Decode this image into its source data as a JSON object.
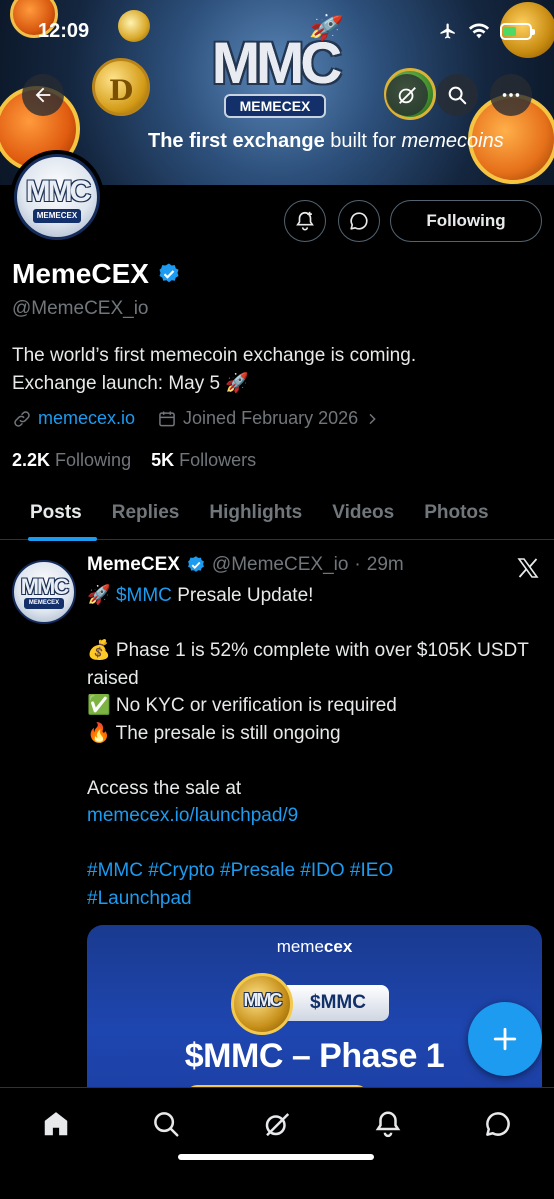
{
  "status_bar": {
    "time": "12:09"
  },
  "banner": {
    "logo_text": "MMC",
    "logo_ribbon": "MEMECEX",
    "tagline_bold": "The first exchange",
    "tagline_regular": "built for",
    "tagline_italic": "memecoins",
    "coin_label": "D"
  },
  "profile": {
    "avatar_logo_text": "MMC",
    "avatar_ribbon": "MEMECEX",
    "display_name": "MemeCEX",
    "handle": "@MemeCEX_io",
    "bio_line1": "The world’s first memecoin exchange is coming.",
    "bio_line2": "Exchange launch: May 5 🚀",
    "website": "memecex.io",
    "joined": "Joined February 2026",
    "following_count": "2.2K",
    "following_label": "Following",
    "followers_count": "5K",
    "followers_label": "Followers",
    "following_button": "Following"
  },
  "tabs": [
    "Posts",
    "Replies",
    "Highlights",
    "Videos",
    "Photos"
  ],
  "active_tab": "Posts",
  "tweet": {
    "author_name": "MemeCEX",
    "author_handle": "@MemeCEX_io",
    "separator": "·",
    "time_ago": "29m",
    "line1_emoji": "🚀",
    "line1_cashtag": "$MMC",
    "line1_text": "Presale Update!",
    "line2": "💰 Phase 1 is 52% complete with over $105K USDT raised",
    "line3": "✅ No KYC or verification is required",
    "line4": "🔥 The presale is still ongoing",
    "line5": "Access the sale at",
    "link": "memecex.io/launchpad/9",
    "hashtags_line1": "#MMC #Crypto #Presale #IDO #IEO",
    "hashtags_line2": "#Launchpad"
  },
  "media": {
    "brand_prefix": "meme",
    "brand_suffix": "cex",
    "coin_logo_text": "MMC",
    "ticker": "$MMC",
    "title": "$MMC – Phase 1"
  },
  "colors": {
    "accent": "#1d9bf0",
    "background": "#000000",
    "muted_text": "#71767b",
    "verified_badge": "#1d9bf0"
  },
  "icons": {
    "back": "arrow-left-icon",
    "grok": "grok-icon",
    "search": "search-icon",
    "more": "more-icon",
    "notifications": "bell-plus-icon",
    "message": "message-icon",
    "verified": "verified-badge-icon",
    "link": "link-icon",
    "calendar": "calendar-icon",
    "chevron": "chevron-right-icon",
    "x_logo": "x-logo-icon",
    "compose": "plus-icon",
    "nav": [
      "home-icon",
      "search-icon",
      "grok-icon",
      "bell-icon",
      "messages-icon"
    ]
  }
}
